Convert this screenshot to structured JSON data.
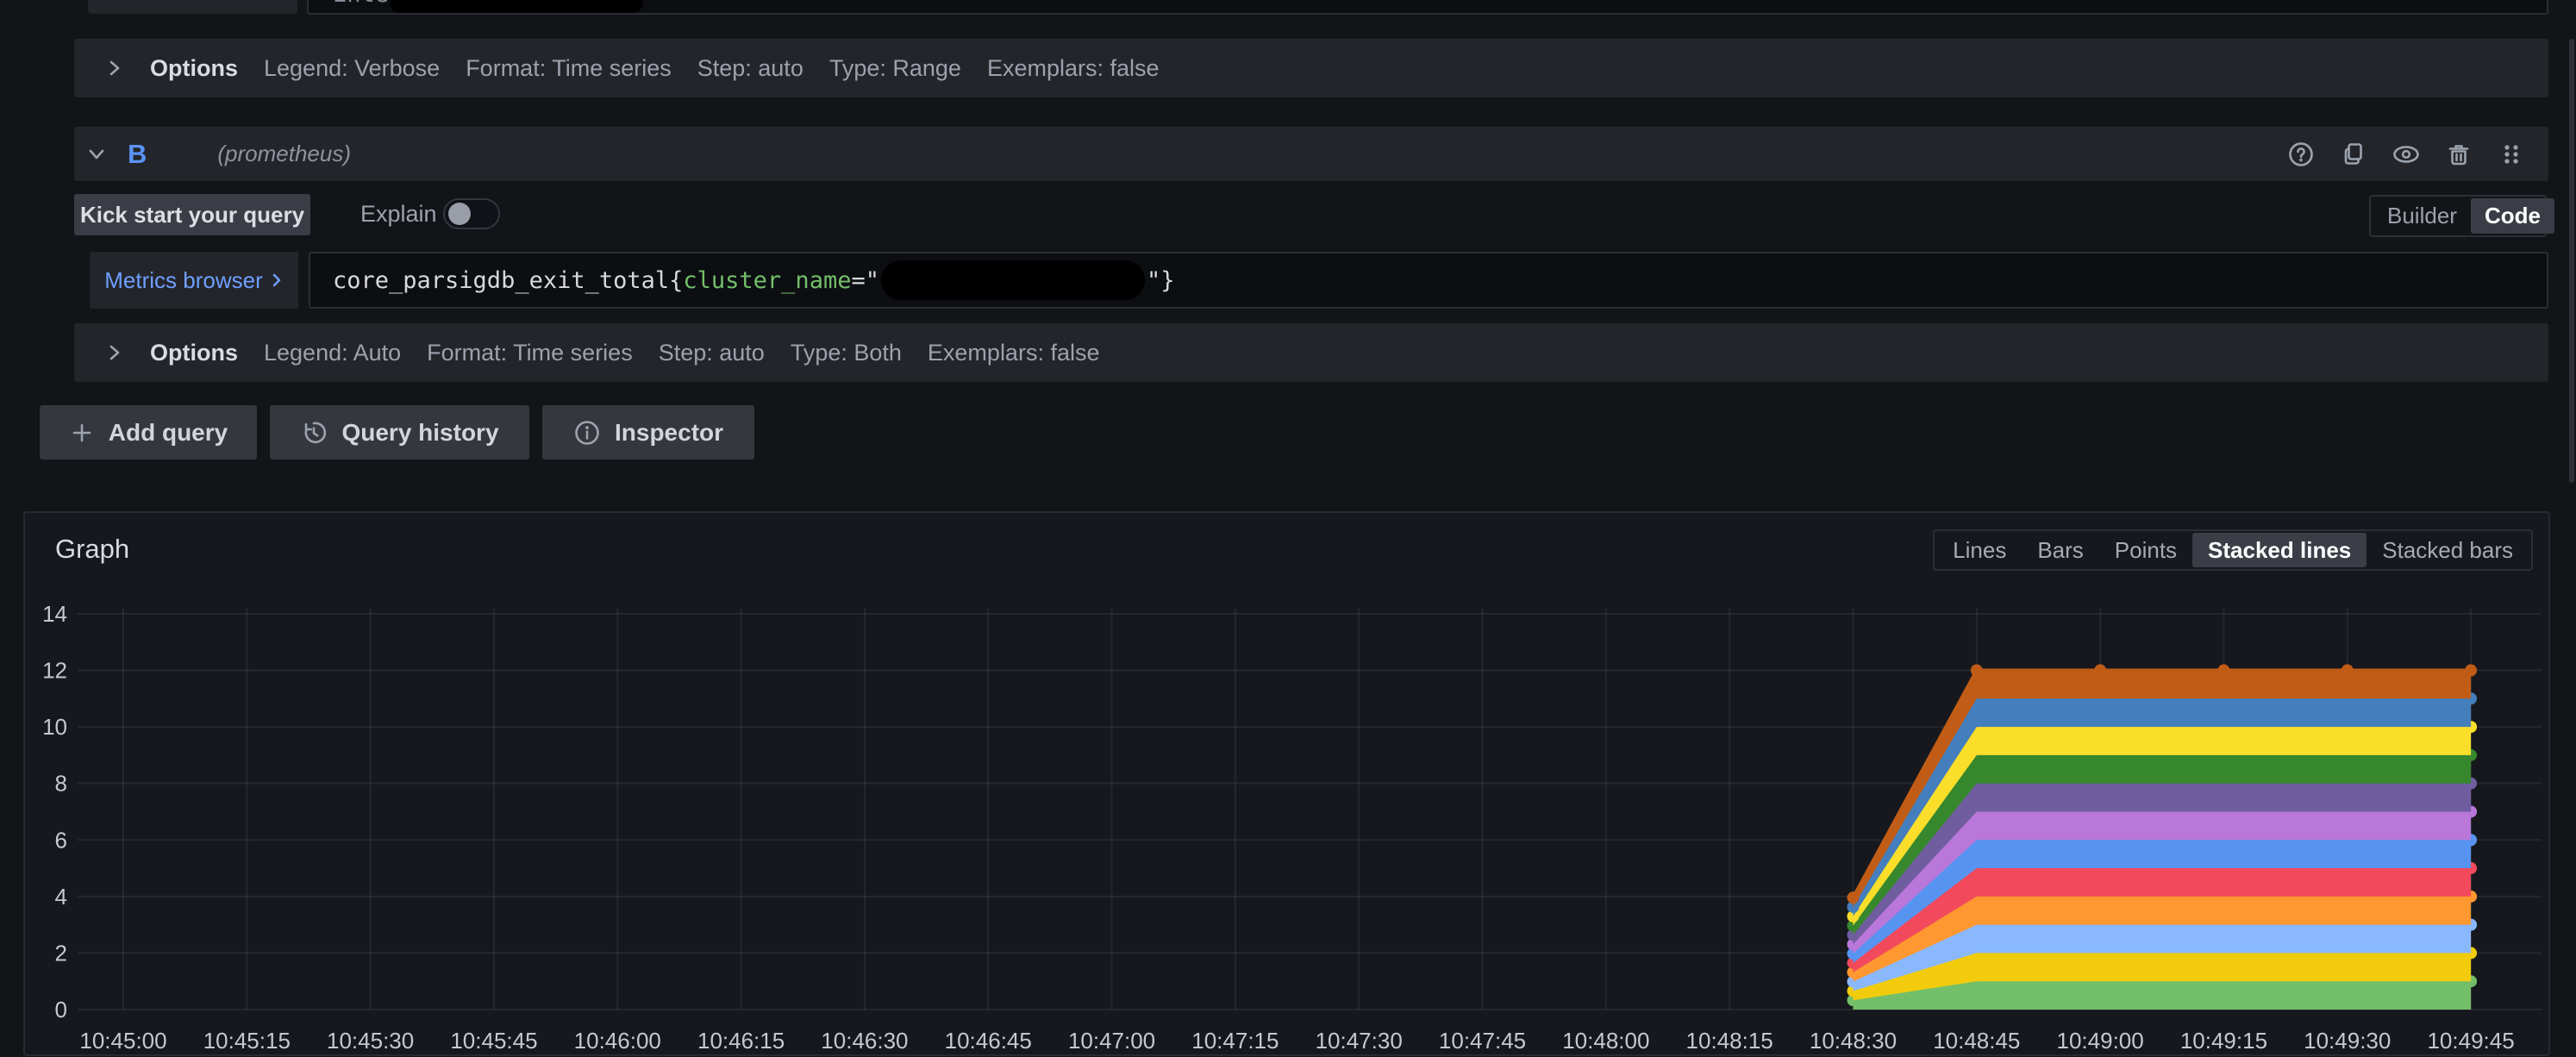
{
  "partial_top_row": {
    "placeholder_fragment": "Enter a PromQL query…",
    "redacted_segment": true
  },
  "query_a": {
    "options_summary": {
      "toggle_label": "Options",
      "items": [
        "Legend: Verbose",
        "Format: Time series",
        "Step: auto",
        "Type: Range",
        "Exemplars: false"
      ]
    }
  },
  "query_b": {
    "ref_id": "B",
    "datasource": "(prometheus)",
    "header_action_icons": [
      "help-circle",
      "duplicate",
      "eye",
      "trash",
      "drag-handle"
    ],
    "kick_start_label": "Kick start your query",
    "explain_label": "Explain",
    "explain_enabled": false,
    "editor_mode": {
      "options": [
        "Builder",
        "Code"
      ],
      "selected": "Code"
    },
    "metrics_browser_label": "Metrics browser",
    "expression": {
      "metric_and_open": "core_parsigdb_exit_total{",
      "label_name": "cluster_name",
      "equals_open_quote": "=\"",
      "value_redacted": true,
      "close_quote_brace": "\"}"
    },
    "options_summary": {
      "toggle_label": "Options",
      "items": [
        "Legend: Auto",
        "Format: Time series",
        "Step: auto",
        "Type: Both",
        "Exemplars: false"
      ]
    }
  },
  "toolbar": {
    "add_query": "Add query",
    "query_history": "Query history",
    "inspector": "Inspector"
  },
  "graph_panel": {
    "title": "Graph",
    "view_modes": [
      "Lines",
      "Bars",
      "Points",
      "Stacked lines",
      "Stacked bars"
    ],
    "active_view_mode": "Stacked lines"
  },
  "chart_data": {
    "type": "area",
    "stacked": true,
    "grid": true,
    "legend_position": "none",
    "ylim": [
      0,
      14
    ],
    "y_ticks": [
      0,
      2,
      4,
      6,
      8,
      10,
      12,
      14
    ],
    "x_tick_labels": [
      "10:45:00",
      "10:45:15",
      "10:45:30",
      "10:45:45",
      "10:46:00",
      "10:46:15",
      "10:46:30",
      "10:46:45",
      "10:47:00",
      "10:47:15",
      "10:47:30",
      "10:47:45",
      "10:48:00",
      "10:48:15",
      "10:48:30",
      "10:48:45",
      "10:49:00",
      "10:49:15",
      "10:49:30",
      "10:49:45"
    ],
    "x": [
      "10:48:30",
      "10:48:45",
      "10:49:00",
      "10:49:15",
      "10:49:30",
      "10:49:45"
    ],
    "series": [
      {
        "name": "",
        "color": "#73BF69",
        "values": [
          0.33,
          1,
          1,
          1,
          1,
          1
        ]
      },
      {
        "name": "",
        "color": "#F2CC0C",
        "values": [
          0.33,
          1,
          1,
          1,
          1,
          1
        ]
      },
      {
        "name": "",
        "color": "#8AB8FF",
        "values": [
          0.33,
          1,
          1,
          1,
          1,
          1
        ]
      },
      {
        "name": "",
        "color": "#FF9830",
        "values": [
          0.33,
          1,
          1,
          1,
          1,
          1
        ]
      },
      {
        "name": "",
        "color": "#F2495C",
        "values": [
          0.33,
          1,
          1,
          1,
          1,
          1
        ]
      },
      {
        "name": "",
        "color": "#5794F2",
        "values": [
          0.33,
          1,
          1,
          1,
          1,
          1
        ]
      },
      {
        "name": "",
        "color": "#B877D9",
        "values": [
          0.33,
          1,
          1,
          1,
          1,
          1
        ]
      },
      {
        "name": "",
        "color": "#705DA0",
        "values": [
          0.33,
          1,
          1,
          1,
          1,
          1
        ]
      },
      {
        "name": "",
        "color": "#37872D",
        "values": [
          0.33,
          1,
          1,
          1,
          1,
          1
        ]
      },
      {
        "name": "",
        "color": "#FADE2A",
        "values": [
          0.33,
          1,
          1,
          1,
          1,
          1
        ]
      },
      {
        "name": "",
        "color": "#447EBC",
        "values": [
          0.33,
          1,
          1,
          1,
          1,
          1
        ]
      },
      {
        "name": "",
        "color": "#C15C17",
        "values": [
          0.33,
          1,
          1,
          1,
          1,
          1
        ]
      }
    ]
  }
}
